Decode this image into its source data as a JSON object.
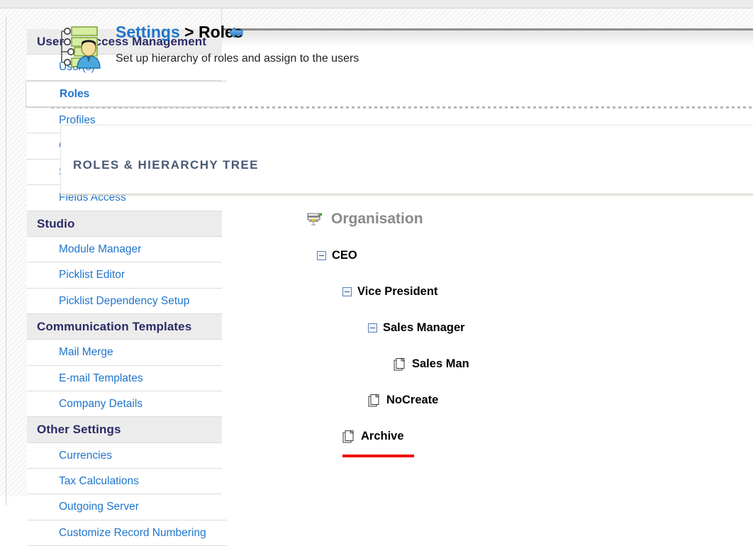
{
  "window": {
    "background_hatch_color": "#fbfbfb",
    "accent_link_color": "#1f75cc",
    "group_heading_color": "#2b2b66",
    "drop_indicator_color": "#ee0000"
  },
  "sidebar": {
    "collapse_arrow_icon": "arrow-left-icon",
    "sections": [
      {
        "heading": "Users & Access Management",
        "items": [
          {
            "label": "User(s)",
            "selected": false
          },
          {
            "label": "Roles",
            "selected": true
          },
          {
            "label": "Profiles",
            "selected": false
          },
          {
            "label": "Groups",
            "selected": false
          },
          {
            "label": "Sharing Access",
            "selected": false
          },
          {
            "label": "Fields Access",
            "selected": false
          }
        ]
      },
      {
        "heading": "Studio",
        "items": [
          {
            "label": "Module Manager",
            "selected": false
          },
          {
            "label": "Picklist Editor",
            "selected": false
          },
          {
            "label": "Picklist Dependency Setup",
            "selected": false
          }
        ]
      },
      {
        "heading": "Communication Templates",
        "items": [
          {
            "label": "Mail Merge",
            "selected": false
          },
          {
            "label": "E-mail Templates",
            "selected": false
          },
          {
            "label": "Company Details",
            "selected": false
          }
        ]
      },
      {
        "heading": "Other Settings",
        "items": [
          {
            "label": "Currencies",
            "selected": false
          },
          {
            "label": "Tax Calculations",
            "selected": false
          },
          {
            "label": "Outgoing Server",
            "selected": false
          },
          {
            "label": "Customize Record Numbering",
            "selected": false
          }
        ]
      }
    ]
  },
  "header": {
    "icon": "roles-hierarchy-icon",
    "breadcrumb_parent": "Settings",
    "breadcrumb_separator": " > ",
    "breadcrumb_current": "Roles",
    "subtitle": "Set up hierarchy of roles and assign to the users"
  },
  "panel": {
    "title": "ROLES & HIERARCHY TREE"
  },
  "tree": {
    "root": {
      "label": "Organisation",
      "icon": "organisation-server-icon"
    },
    "nodes": [
      {
        "label": "CEO",
        "depth": 0,
        "icon": "collapse-toggle-minus-icon",
        "expanded": true
      },
      {
        "label": "Vice President",
        "depth": 1,
        "icon": "collapse-toggle-minus-icon",
        "expanded": true
      },
      {
        "label": "Sales Manager",
        "depth": 2,
        "icon": "collapse-toggle-minus-icon",
        "expanded": true
      },
      {
        "label": "Sales Man",
        "depth": 3,
        "icon": "document-leaf-icon",
        "expanded": false
      },
      {
        "label": "NoCreate",
        "depth": 2,
        "icon": "document-leaf-icon",
        "expanded": false
      },
      {
        "label": "Archive",
        "depth": 1,
        "icon": "document-leaf-icon",
        "expanded": false
      }
    ]
  }
}
